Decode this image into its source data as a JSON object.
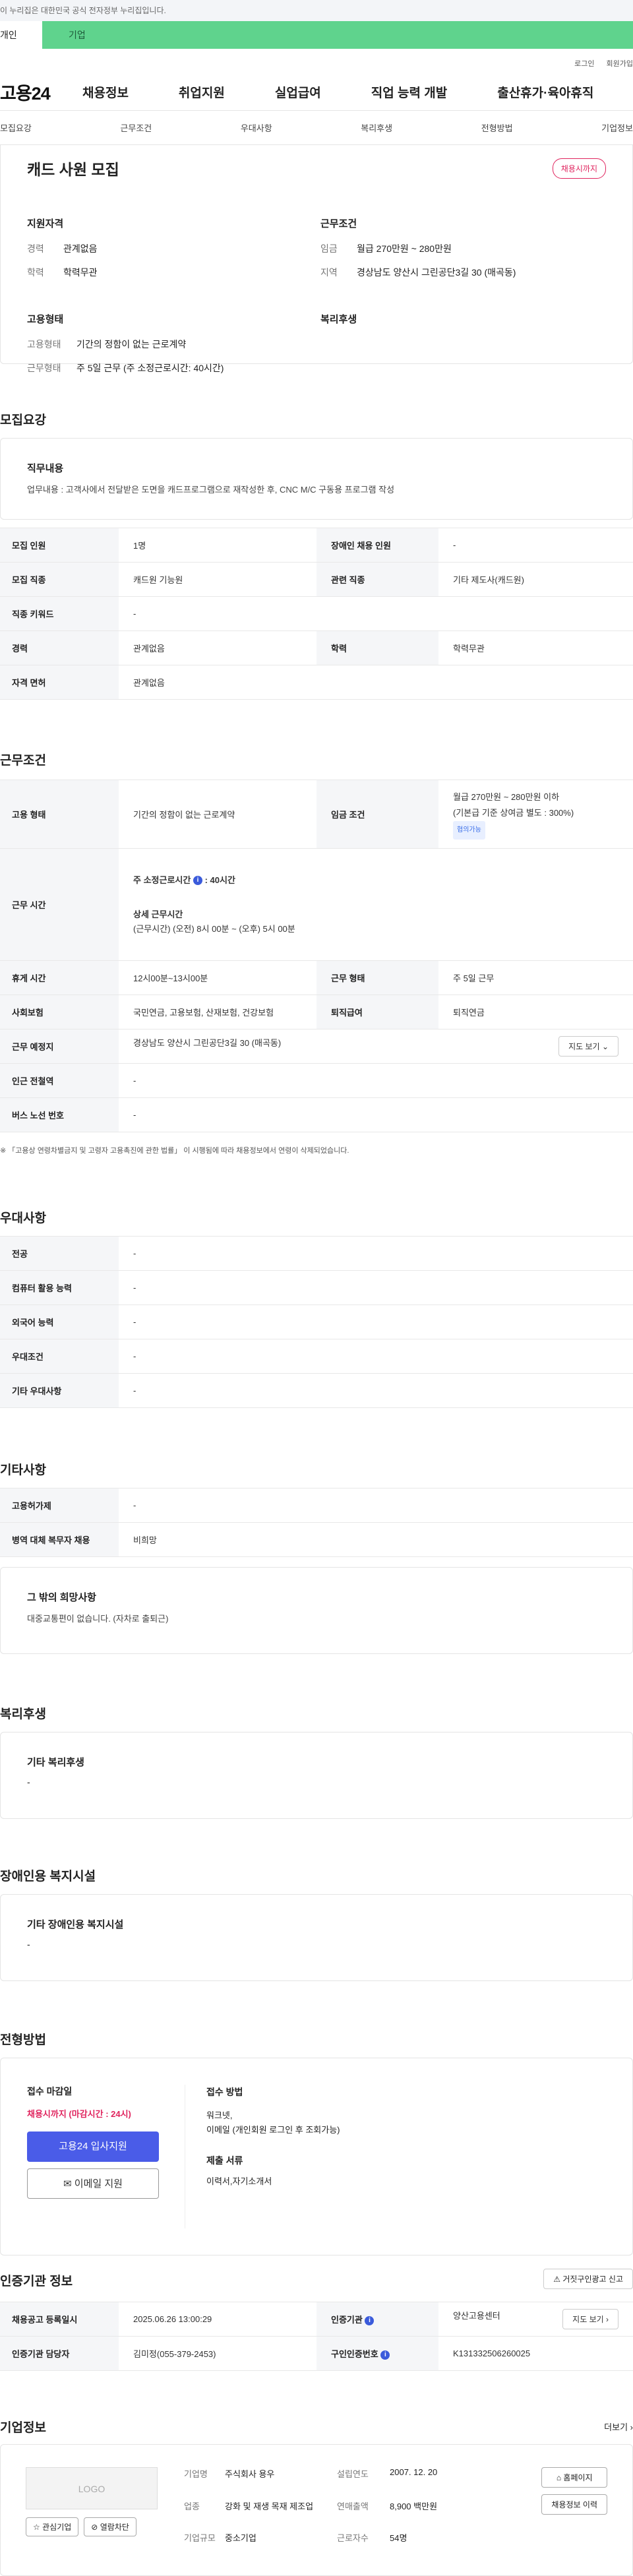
{
  "top_notice": "이 누리집은 대한민국 공식 전자정부 누리집입니다.",
  "tabs": {
    "person": "개인",
    "biz": "기업"
  },
  "util": [
    "로그인",
    "회원가입"
  ],
  "logo": "고용24",
  "gnb": [
    "채용정보",
    "취업지원",
    "실업급여",
    "직업 능력 개발",
    "출산휴가·육아휴직"
  ],
  "subnav": [
    "모집요강",
    "근무조건",
    "우대사항",
    "복리후생",
    "전형방법",
    "기업정보"
  ],
  "title": {
    "name": "캐드 사원 모집",
    "badge": "채용시까지"
  },
  "summary": {
    "qual_head": "지원자격",
    "qual": [
      [
        "경력",
        "관계없음"
      ],
      [
        "학력",
        "학력무관"
      ]
    ],
    "cond_head": "근무조건",
    "cond": [
      [
        "임금",
        "월급 270만원 ~ 280만원"
      ],
      [
        "지역",
        "경상남도 양산시 그린공단3길 30 (매곡동)"
      ]
    ],
    "type_head": "고용형태",
    "type": [
      [
        "고용형태",
        "기간의 정함이 없는 근로계약"
      ],
      [
        "근무형태",
        "주 5일 근무 (주 소정근로시간: 40시간)"
      ]
    ],
    "welfare_head": "복리후생"
  },
  "recruit": {
    "title": "모집요강",
    "duty_head": "직무내용",
    "duty": "업무내용 : 고객사에서 전달받은 도면을 캐드프로그램으로 재작성한 후, CNC M/C 구동용 프로그램 작성",
    "rows": [
      [
        "모집 인원",
        "1명",
        "장애인 채용 인원",
        "-"
      ],
      [
        "모집 직종",
        "캐드원 기능원",
        "관련 직종",
        "기타 제도사(캐드원)"
      ],
      [
        "직종 키워드",
        "-"
      ],
      [
        "경력",
        "관계없음",
        "학력",
        "학력무관"
      ],
      [
        "자격 면허",
        "관계없음"
      ]
    ]
  },
  "work": {
    "title": "근무조건",
    "type_k": "고용 형태",
    "type_v": "기간의 정함이 없는 근로계약",
    "wage_k": "임금 조건",
    "wage_v1": "월급 270만원 ~ 280만원 이하",
    "wage_v2": "(기본급 기준 상여금 별도 : 300%)",
    "wage_chip": "협의가능",
    "time_k": "근무 시간",
    "time_v1": "주 소정근로시간",
    "time_v1b": ": 40시간",
    "time_v2": "상세 근무시간",
    "time_v3": "(근무시간) (오전) 8시 00분 ~ (오후) 5시 00분",
    "rest_k": "휴게 시간",
    "rest_v": "12시00분~13시00분",
    "form_k": "근무 형태",
    "form_v": "주 5일 근무",
    "ins_k": "사회보험",
    "ins_v": "국민연금, 고용보험, 산재보험, 건강보험",
    "ret_k": "퇴직급여",
    "ret_v": "퇴직연금",
    "place_k": "근무 예정지",
    "place_v": "경상남도 양산시 그린공단3길 30 (매곡동)",
    "map_btn": "지도 보기",
    "sub_k": "인근 전철역",
    "sub_v": "-",
    "bus_k": "버스 노선 번호",
    "bus_v": "-",
    "note": "※ 「고용상 연령차별금지 및 고령자 고용촉진에 관한 법률」 이 시행됨에 따라 채용정보에서 연령이 삭제되었습니다."
  },
  "pref": {
    "title": "우대사항",
    "rows": [
      [
        "전공",
        "-"
      ],
      [
        "컴퓨터 활용 능력",
        "-"
      ],
      [
        "외국어 능력",
        "-"
      ],
      [
        "우대조건",
        "-"
      ],
      [
        "기타 우대사항",
        "-"
      ]
    ]
  },
  "etc": {
    "title": "기타사항",
    "rows": [
      [
        "고용허가제",
        "-"
      ],
      [
        "병역 대체 복무자 채용",
        "비희망"
      ]
    ],
    "wish_head": "그 밖의 희망사항",
    "wish": "대중교통편이 없습니다. (자차로 출퇴근)"
  },
  "welfare": {
    "title": "복리후생",
    "head": "기타 복리후생",
    "value": "-"
  },
  "disabled": {
    "title": "장애인용 복지시설",
    "head": "기타 장애인용 복지시설",
    "value": "-"
  },
  "apply": {
    "title": "전형방법",
    "deadline_head": "접수 마감일",
    "deadline": "채용시까지 (마감시간 : 24시)",
    "btn1": "고용24 입사지원",
    "btn2": "이메일 지원",
    "method_head": "접수 방법",
    "method": [
      "워크넷,",
      "이메일 (개인회원 로그인 후 조회가능)"
    ],
    "docs_head": "제출 서류",
    "docs": "이력서,자기소개서"
  },
  "cert": {
    "title": "인증기관 정보",
    "report_btn": "거짓구인광고 신고",
    "rows": [
      [
        "채용공고 등록일시",
        "2025.06.26 13:00:29",
        "인증기관",
        "양산고용센터"
      ],
      [
        "인증기관 담당자",
        "김미정(055-379-2453)",
        "구인인증번호",
        "K131332506260025"
      ]
    ],
    "detail_btn": "지도 보기"
  },
  "company": {
    "title": "기업정보",
    "more": "더보기",
    "logo": "LOGO",
    "fav": "관심기업",
    "block": "열람차단",
    "name_k": "기업명",
    "name_v": "주식회사 용우",
    "biz_k": "업종",
    "biz_v": "강화 및 재생 목재 제조업",
    "size_k": "기업규모",
    "size_v": "중소기업",
    "year_k": "설립연도",
    "year_v": "2007. 12. 20",
    "sales_k": "연매출액",
    "sales_v": "8,900 백만원",
    "emp_k": "근로자수",
    "emp_v": "54명",
    "home_btn": "홈페이지",
    "hist_btn": "채용정보 이력"
  }
}
